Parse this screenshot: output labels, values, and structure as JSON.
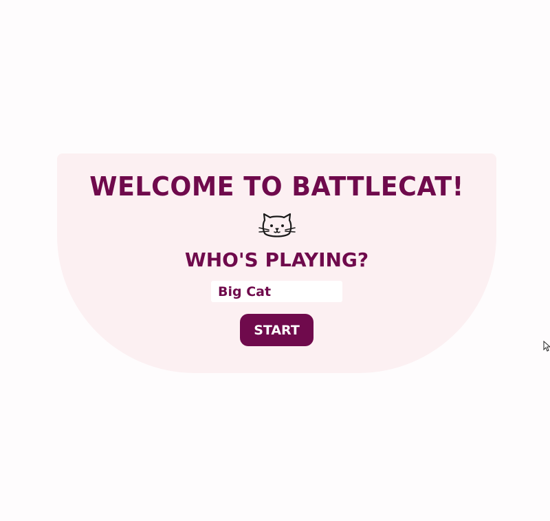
{
  "welcome": {
    "title": "WELCOME TO BATTLECAT!",
    "icon": "cat-face-icon",
    "question": "WHO'S PLAYING?"
  },
  "player_name": {
    "value": "Big Cat",
    "placeholder": ""
  },
  "start_button": {
    "label": "START"
  },
  "colors": {
    "page_background": "#fefcfd",
    "card_background": "#fcf0f2",
    "accent": "#6f0a4c",
    "input_background": "#ffffff",
    "button_text": "#ffffff"
  }
}
